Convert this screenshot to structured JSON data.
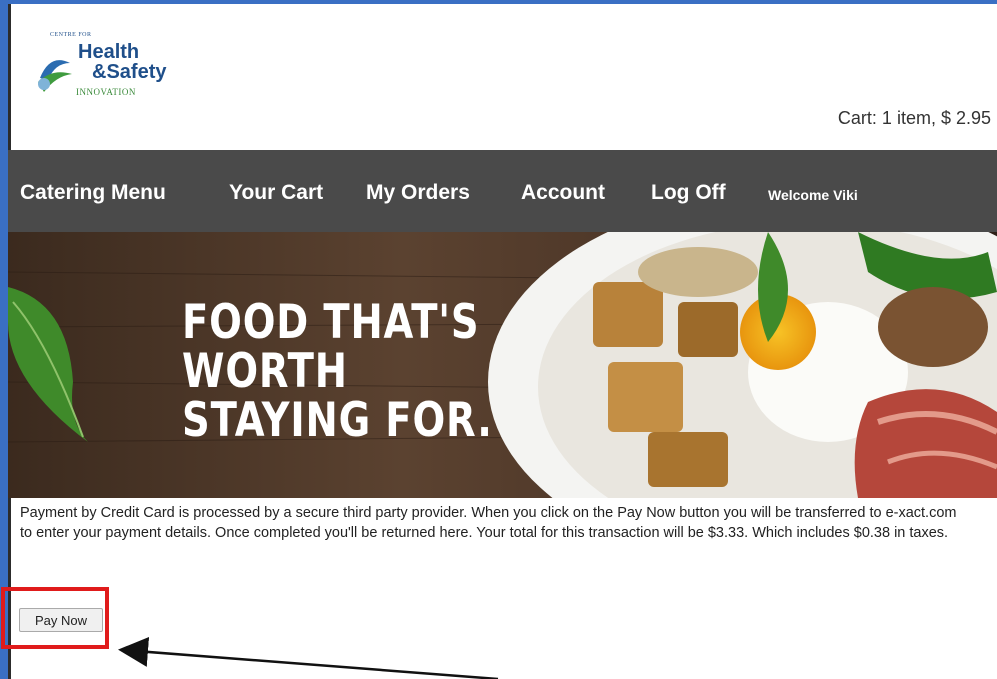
{
  "header": {
    "logo": {
      "line1": "CENTRE FOR",
      "line2": "Health",
      "line3": "&Safety",
      "line4": "INNOVATION"
    },
    "cart_summary": "Cart: 1 item, $ 2.95"
  },
  "nav": {
    "items": [
      {
        "label": "Catering Menu"
      },
      {
        "label": "Your Cart"
      },
      {
        "label": "My Orders"
      },
      {
        "label": "Account"
      },
      {
        "label": "Log Off"
      }
    ],
    "welcome": "Welcome Viki"
  },
  "banner": {
    "headline_line1": "FOOD THAT'S",
    "headline_line2": "WORTH",
    "headline_line3": "STAYING FOR."
  },
  "payment": {
    "notice": "Payment by Credit Card is processed by a secure third party provider. When you click on the Pay Now button you will be transferred to e-xact.com to enter your payment details. Once completed you'll be returned here. Your total for this transaction will be $3.33. Which includes $0.38 in taxes.",
    "pay_button_label": "Pay Now"
  },
  "colors": {
    "nav_background": "#4a4a4a",
    "page_background": "#3a6fc4",
    "highlight": "#e01b1b"
  }
}
